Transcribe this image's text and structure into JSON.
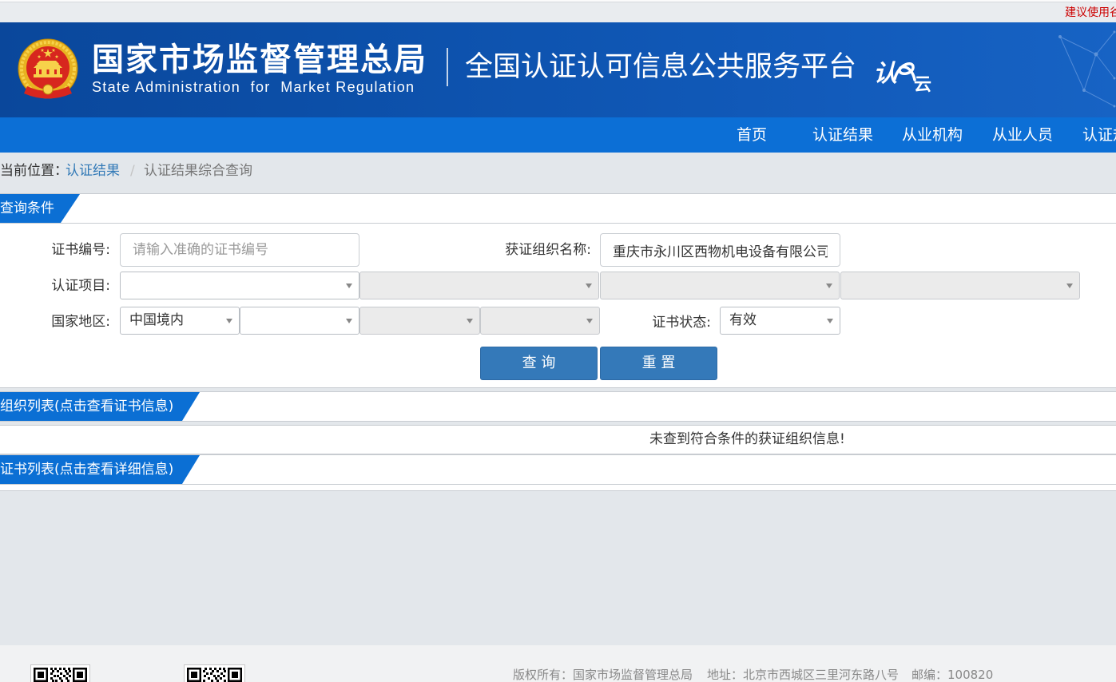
{
  "topbar": {
    "notice": "建议使用谷"
  },
  "header": {
    "org_cn": "国家市场监督管理总局",
    "org_en": "State Administration  for  Market Regulation",
    "platform_title": "全国认证认可信息公共服务平台",
    "logo_text": {
      "first": "认",
      "last": "云"
    }
  },
  "nav": {
    "items": [
      {
        "label": "首页"
      },
      {
        "label": "认证结果"
      },
      {
        "label": "从业机构"
      },
      {
        "label": "从业人员"
      },
      {
        "label": "认证规"
      }
    ]
  },
  "breadcrumb": {
    "prefix": "当前位置：",
    "link": "认证结果",
    "separator": "/",
    "current": "认证结果综合查询"
  },
  "query_panel": {
    "title": "查询条件",
    "cert_no": {
      "label": "证书编号:",
      "placeholder": "请输入准确的证书编号"
    },
    "org_name": {
      "label": "获证组织名称:",
      "value": "重庆市永川区西物机电设备有限公司"
    },
    "cert_project": {
      "label": "认证项目:",
      "selects": [
        {
          "disabled": false
        },
        {
          "disabled": true
        },
        {
          "disabled": true
        },
        {
          "disabled": true
        }
      ]
    },
    "region": {
      "label": "国家地区:",
      "selects": [
        {
          "value": "中国境内",
          "disabled": false
        },
        {
          "disabled": false
        },
        {
          "disabled": true
        },
        {
          "disabled": true
        }
      ]
    },
    "cert_status": {
      "label": "证书状态:",
      "value": "有效"
    },
    "search_button": "查 询",
    "reset_button": "重 置"
  },
  "org_list": {
    "title": "组织列表(点击查看证书信息)",
    "empty_message": "未查到符合条件的获证组织信息!"
  },
  "cert_list": {
    "title": "证书列表(点击查看详细信息)"
  },
  "footer": {
    "copyright": "版权所有：国家市场监督管理总局",
    "address": "地址：北京市西城区三里河东路八号",
    "postcode": "邮编：100820"
  },
  "icons": {
    "emblem": "national-emblem-icon",
    "select_caret": "caret-down-icon",
    "qr": "qr-code-icon",
    "logo": "renzheng-yun-logo"
  },
  "colors": {
    "header_bg": "#0d52ad",
    "nav_bg": "#0c6fd6",
    "tab_bg": "#0b6fd4",
    "link": "#337ab7",
    "button_bg": "#3479b9",
    "notice": "#cc0000",
    "page_bg": "#e3e7eb"
  }
}
